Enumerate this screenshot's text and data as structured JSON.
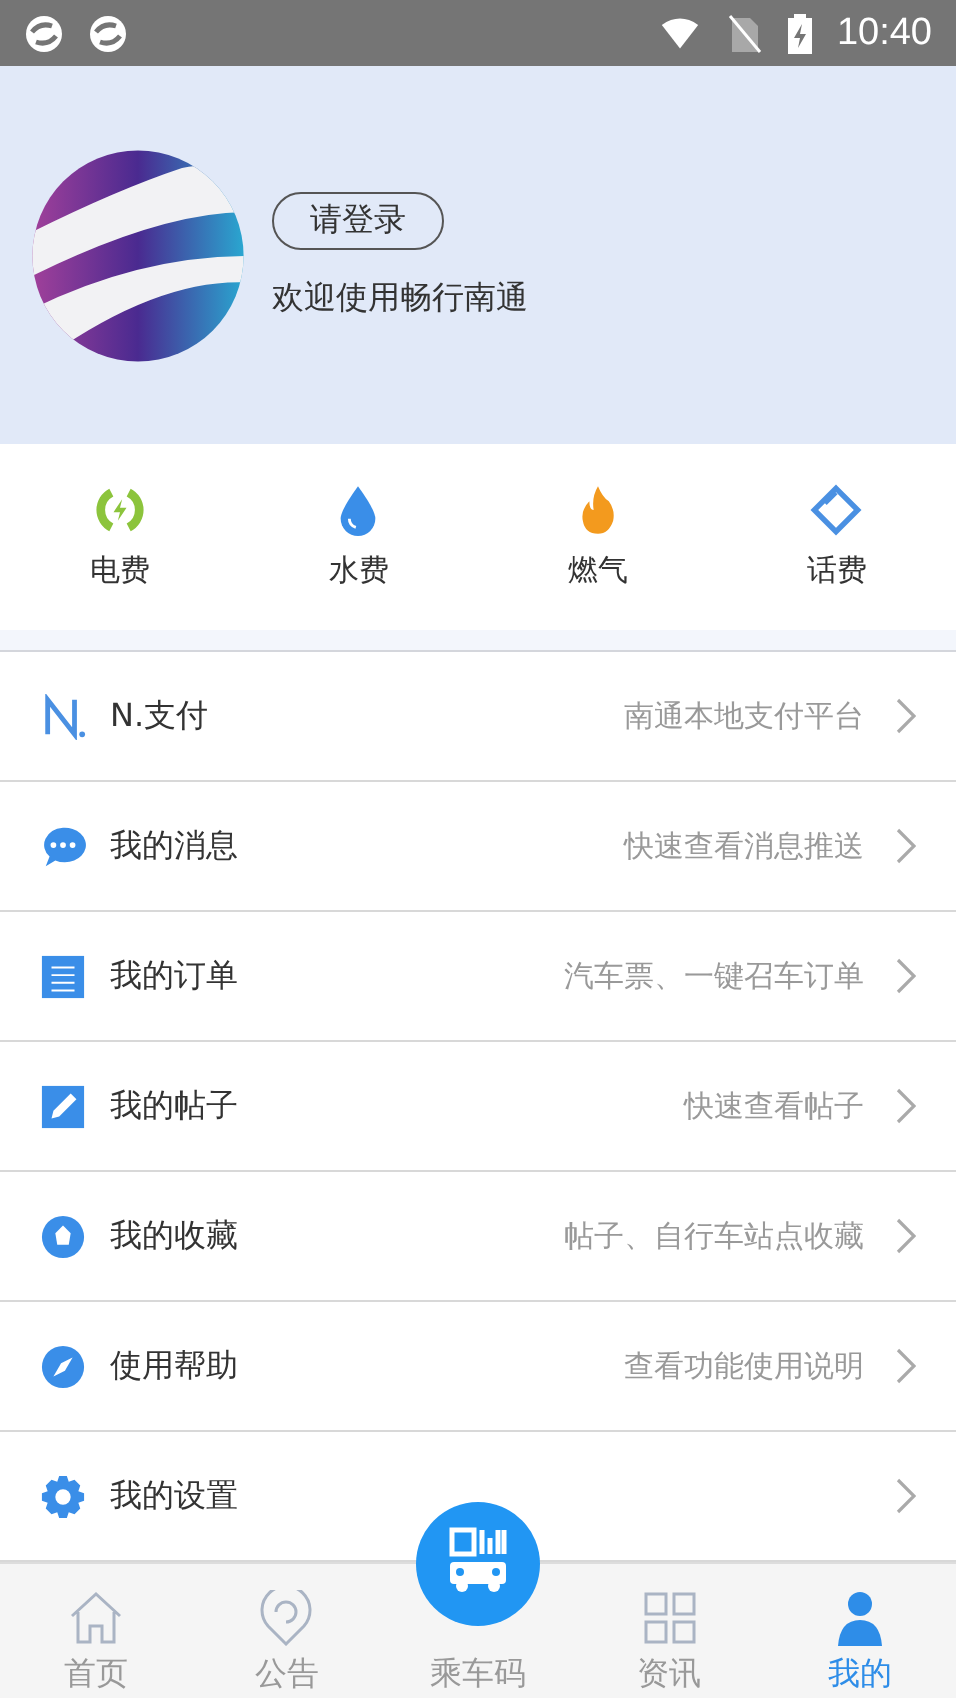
{
  "status_bar": {
    "time": "10:40"
  },
  "profile": {
    "login_button": "请登录",
    "welcome": "欢迎使用畅行南通"
  },
  "services": [
    {
      "kind": "electric",
      "label": "电费"
    },
    {
      "kind": "water",
      "label": "水费"
    },
    {
      "kind": "gas",
      "label": "燃气"
    },
    {
      "kind": "phone",
      "label": "话费"
    }
  ],
  "menu": [
    {
      "kind": "npay",
      "label": "N.支付",
      "hint": "南通本地支付平台"
    },
    {
      "kind": "message",
      "label": "我的消息",
      "hint": "快速查看消息推送"
    },
    {
      "kind": "order",
      "label": "我的订单",
      "hint": "汽车票、一键召车订单"
    },
    {
      "kind": "post",
      "label": "我的帖子",
      "hint": "快速查看帖子"
    },
    {
      "kind": "favorite",
      "label": "我的收藏",
      "hint": "帖子、自行车站点收藏"
    },
    {
      "kind": "help",
      "label": "使用帮助",
      "hint": "查看功能使用说明"
    },
    {
      "kind": "settings",
      "label": "我的设置"
    }
  ],
  "tab_bar": [
    {
      "kind": "home",
      "label": "首页",
      "selected": false
    },
    {
      "kind": "notice",
      "label": "公告",
      "selected": false
    },
    {
      "kind": "code",
      "label": "乘车码",
      "selected": false
    },
    {
      "kind": "news",
      "label": "资讯",
      "selected": false
    },
    {
      "kind": "mine",
      "label": "我的",
      "selected": true
    }
  ]
}
